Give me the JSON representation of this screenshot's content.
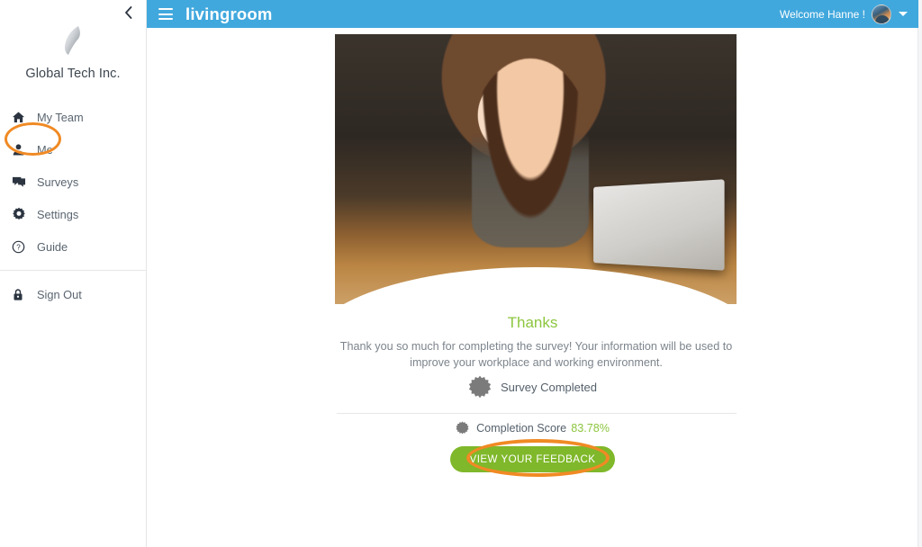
{
  "sidebar": {
    "collapse_icon": "chevron-left-icon",
    "brand_logo_icon": "feather-logo",
    "brand_name": "Global Tech Inc.",
    "items": [
      {
        "label": "My Team",
        "icon": "home-icon",
        "active": false
      },
      {
        "label": "Me",
        "icon": "person-icon",
        "active": true
      },
      {
        "label": "Surveys",
        "icon": "chat-bubbles-icon",
        "active": false
      },
      {
        "label": "Settings",
        "icon": "gear-icon",
        "active": false
      },
      {
        "label": "Guide",
        "icon": "question-circle-icon",
        "active": false
      }
    ],
    "signout": {
      "label": "Sign Out",
      "icon": "lock-icon"
    }
  },
  "topbar": {
    "menu_icon": "hamburger-icon",
    "logo_text": "livingroom",
    "welcome_text": "Welcome Hanne !",
    "avatar_icon": "user-avatar",
    "caret_icon": "chevron-down-icon"
  },
  "main": {
    "hero_image_alt": "woman-smiling-with-laptop-photo",
    "title": "Thanks",
    "body": "Thank you so much for completing the survey! Your information will be used to improve your workplace and working environment.",
    "completed_badge_icon": "starburst-badge-icon",
    "completed_label": "Survey Completed",
    "score_badge_icon": "starburst-badge-icon",
    "score_label": "Completion Score",
    "score_value": "83.78%",
    "feedback_button": "VIEW YOUR FEEDBACK"
  },
  "annotations": {
    "me_highlight": "orange-ellipse-highlight",
    "feedback_highlight": "orange-ellipse-highlight"
  },
  "colors": {
    "topbar_blue": "#41a8dd",
    "accent_green": "#8cc63e",
    "button_green": "#7fb82a",
    "highlight_orange": "#f08a24",
    "text_grey": "#5a6570",
    "muted_text": "#7c848c"
  }
}
